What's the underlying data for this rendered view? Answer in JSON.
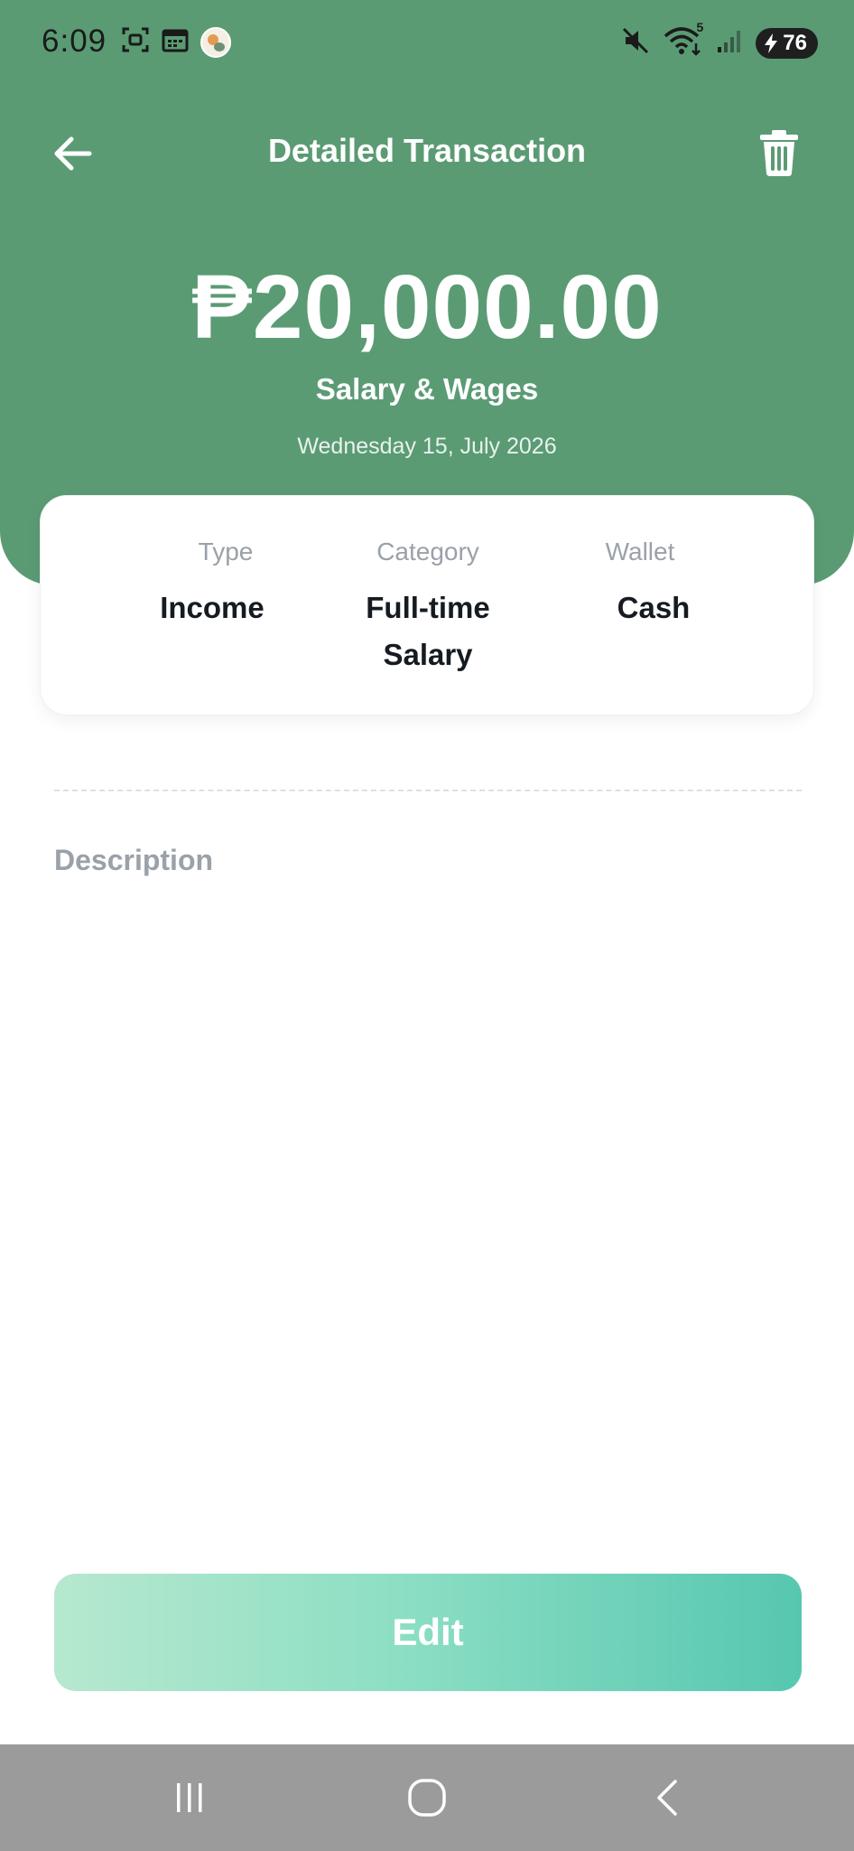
{
  "status_bar": {
    "time": "6:09",
    "left_icons": [
      "screenshot-icon",
      "calendar-icon",
      "avatar-icon"
    ],
    "right_icons": [
      "mute-icon",
      "wifi-icon",
      "signal-icon"
    ],
    "wifi_badge": "5",
    "battery": "76"
  },
  "header": {
    "title": "Detailed Transaction",
    "back_icon": "back-arrow-icon",
    "delete_icon": "trash-icon"
  },
  "transaction": {
    "amount": "₱20,000.00",
    "title": "Salary & Wages",
    "date": "Wednesday 15, July 2026"
  },
  "details": {
    "type_label": "Type",
    "type_value": "Income",
    "category_label": "Category",
    "category_value": "Full-time Salary",
    "wallet_label": "Wallet",
    "wallet_value": "Cash"
  },
  "description": {
    "label": "Description",
    "text": ""
  },
  "actions": {
    "edit_label": "Edit"
  },
  "nav_bar": {
    "items": [
      "recents-icon",
      "home-icon",
      "back-icon"
    ]
  },
  "colors": {
    "header_bg": "#5a9b74",
    "edit_gradient_start": "#b7e8cf",
    "edit_gradient_end": "#57c7b0",
    "label_gray": "#9aa1a9",
    "value_dark": "#161b22",
    "nav_bg": "#9b9b9b"
  }
}
